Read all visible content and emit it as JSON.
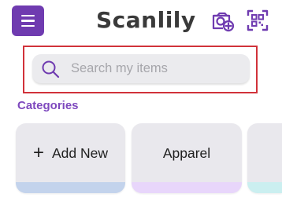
{
  "header": {
    "title": "Scanlily",
    "menu_icon": "hamburger-menu-icon",
    "camera_icon": "camera-add-icon",
    "scan_icon": "scan-qr-icon",
    "accent": "#6f3bb0"
  },
  "search": {
    "placeholder": "Search my items",
    "value": "",
    "icon": "search-icon",
    "highlight_color": "#d1323a"
  },
  "categories": {
    "label": "Categories",
    "label_color": "#7e49be",
    "items": [
      {
        "label": "Add New",
        "icon": "plus-icon",
        "strip_color": "#c3d3ec"
      },
      {
        "label": "Apparel",
        "strip_color": "#e8d6fb"
      },
      {
        "label": "",
        "strip_color": "#cbeff0"
      }
    ]
  }
}
